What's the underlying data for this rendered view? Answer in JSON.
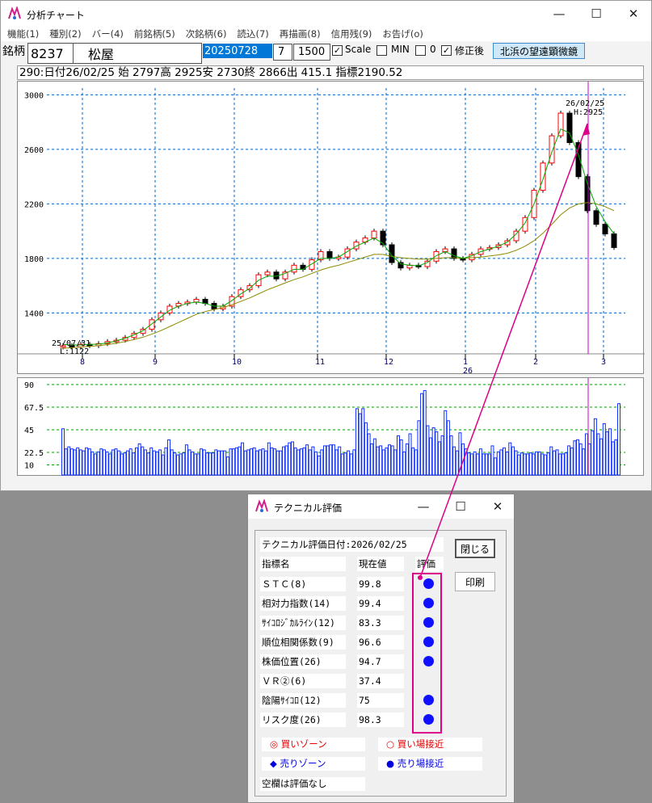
{
  "main_window": {
    "title": "分析チャート",
    "menu": [
      "機能(1)",
      "種別(2)",
      "バー(4)",
      "前銘柄(5)",
      "次銘柄(6)",
      "読込(7)",
      "再描画(8)",
      "信用残(9)",
      "お告げ(o)"
    ],
    "toolbar": {
      "stock_label": "銘柄",
      "code": "8237",
      "name": "松屋",
      "date": "20250728",
      "period": "7",
      "count": "1500",
      "scale_label": "Scale",
      "scale_checked": true,
      "min_label": "MIN",
      "min_checked": false,
      "zero_label": "0",
      "zero_checked": false,
      "adjusted_label": "修正後",
      "adjusted_checked": true,
      "telescope_button": "北浜の望遠顕微鏡"
    },
    "info_line": "290:日付26/02/25 始 2797高 2925安 2730終 2866出 415.1 指標2190.52"
  },
  "chart_data": [
    {
      "type": "candlestick",
      "y_ticks": [
        "3000",
        "2600",
        "2200",
        "1800",
        "1400"
      ],
      "ylim": [
        1100,
        3050
      ],
      "x_month_labels": [
        "8",
        "9",
        "10",
        "11",
        "12",
        "1",
        "2",
        "3"
      ],
      "x_year_label": "26",
      "annotation_high_date": "26/02/25",
      "annotation_high_value": "H:2925",
      "annotation_low_date": "25/07/31",
      "annotation_low_value": "L:1122",
      "grid": true,
      "close_approx": [
        1160,
        1150,
        1170,
        1160,
        1175,
        1190,
        1200,
        1220,
        1250,
        1280,
        1350,
        1400,
        1450,
        1470,
        1480,
        1500,
        1470,
        1430,
        1450,
        1520,
        1570,
        1600,
        1680,
        1700,
        1650,
        1700,
        1750,
        1720,
        1790,
        1850,
        1800,
        1810,
        1870,
        1920,
        1950,
        2000,
        1900,
        1770,
        1730,
        1750,
        1740,
        1780,
        1850,
        1870,
        1800,
        1790,
        1830,
        1870,
        1880,
        1900,
        1930,
        2000,
        2100,
        2300,
        2500,
        2700,
        2866,
        2650,
        2400,
        2150,
        2050,
        1980,
        1880
      ],
      "ma_short_approx": [
        1170,
        1165,
        1165,
        1168,
        1172,
        1180,
        1195,
        1215,
        1240,
        1270,
        1320,
        1370,
        1420,
        1450,
        1470,
        1480,
        1470,
        1450,
        1450,
        1490,
        1540,
        1580,
        1640,
        1670,
        1670,
        1690,
        1720,
        1720,
        1760,
        1800,
        1800,
        1810,
        1850,
        1890,
        1920,
        1950,
        1910,
        1820,
        1760,
        1750,
        1745,
        1770,
        1820,
        1850,
        1820,
        1800,
        1820,
        1850,
        1870,
        1890,
        1920,
        1980,
        2060,
        2200,
        2380,
        2580,
        2750,
        2720,
        2560,
        2350,
        2180,
        2070,
        1980
      ],
      "ma_long_approx": [
        1140,
        1145,
        1150,
        1155,
        1160,
        1168,
        1178,
        1190,
        1205,
        1222,
        1245,
        1270,
        1300,
        1330,
        1360,
        1390,
        1410,
        1425,
        1440,
        1460,
        1485,
        1510,
        1540,
        1570,
        1595,
        1620,
        1645,
        1665,
        1690,
        1715,
        1735,
        1750,
        1770,
        1790,
        1810,
        1830,
        1830,
        1815,
        1805,
        1800,
        1795,
        1795,
        1800,
        1805,
        1805,
        1800,
        1805,
        1810,
        1818,
        1826,
        1838,
        1860,
        1890,
        1930,
        1985,
        2050,
        2120,
        2170,
        2200,
        2210,
        2200,
        2180,
        2150
      ]
    },
    {
      "type": "bar",
      "y_ticks": [
        "90",
        "67.5",
        "45",
        "22.5",
        "10"
      ],
      "ylim": [
        0,
        90
      ],
      "values_approx": [
        46,
        26,
        28,
        26,
        25,
        27,
        25,
        24,
        27,
        26,
        23,
        21,
        23,
        26,
        25,
        23,
        21,
        25,
        26,
        24,
        21,
        22,
        24,
        26,
        22,
        27,
        31,
        28,
        25,
        22,
        27,
        24,
        23,
        25,
        20,
        27,
        35,
        25,
        22,
        20,
        21,
        22,
        30,
        25,
        23,
        21,
        21,
        26,
        25,
        22,
        22,
        22,
        25,
        24,
        24,
        24,
        18,
        26,
        26,
        27,
        28,
        32,
        24,
        25,
        26,
        27,
        24,
        25,
        26,
        24,
        32,
        27,
        26,
        24,
        24,
        28,
        29,
        32,
        33,
        27,
        25,
        26,
        27,
        30,
        25,
        28,
        23,
        19,
        25,
        29,
        29,
        30,
        30,
        25,
        28,
        21,
        22,
        24,
        21,
        25,
        66,
        61,
        66,
        52,
        41,
        31,
        36,
        28,
        29,
        25,
        27,
        30,
        29,
        25,
        39,
        35,
        23,
        31,
        41,
        27,
        25,
        54,
        81,
        84,
        49,
        37,
        47,
        43,
        33,
        39,
        64,
        54,
        39,
        28,
        24,
        42,
        31,
        26,
        22,
        21,
        23,
        21,
        26,
        21,
        21,
        21,
        29,
        17,
        23,
        25,
        27,
        23,
        32,
        28,
        24,
        20,
        22,
        21,
        21,
        22,
        21,
        23,
        23,
        21,
        20,
        22,
        28,
        24,
        25,
        21,
        21,
        22,
        29,
        27,
        34,
        35,
        31,
        26,
        41,
        31,
        44,
        56,
        41,
        36,
        51,
        43,
        46,
        33,
        35,
        71
      ]
    }
  ],
  "colors": {
    "bull_candle": "#ffffff",
    "bear_candle": "#000000",
    "candle_outline_up": "#ff0000",
    "ma_short": "#00aa00",
    "ma_long": "#8b8b00",
    "grid": "#0066cc",
    "volume_bar": "#1030ff",
    "marker_line": "#cc00cc",
    "arrow": "#dd0088",
    "eval_dot": "#1010ff",
    "buy_text": "#e00000",
    "sell_text": "#0000e0"
  },
  "tech_window": {
    "title": "テクニカル評価",
    "eval_date_label": "テクニカル評価日付:2026/02/25",
    "col_indicator": "指標名",
    "col_value": "現在値",
    "col_rating": "評価",
    "close_button": "閉じる",
    "print_button": "印刷",
    "rows": [
      {
        "name": "ＳＴＣ(8)",
        "value": "99.8",
        "rating": "sell-near"
      },
      {
        "name": "相対力指数(14)",
        "value": "99.4",
        "rating": "sell-near"
      },
      {
        "name": "ｻｲｺﾛｼﾞｶﾙﾗｲﾝ(12)",
        "value": "83.3",
        "rating": "sell-near"
      },
      {
        "name": "順位相関係数(9)",
        "value": "96.6",
        "rating": "sell-near"
      },
      {
        "name": "株価位置(26)",
        "value": "94.7",
        "rating": "sell-near"
      },
      {
        "name": "ＶＲ②(6)",
        "value": "37.4",
        "rating": ""
      },
      {
        "name": "陰陽ｻｲｺﾛ(12)",
        "value": "75",
        "rating": "sell-near"
      },
      {
        "name": "リスク度(26)",
        "value": "98.3",
        "rating": "sell-near"
      }
    ],
    "legend": {
      "buy_zone_symbol": "◎",
      "buy_zone": "買いゾーン",
      "buy_near_symbol": "○",
      "buy_near": "買い場接近",
      "sell_zone_symbol": "◆",
      "sell_zone": "売りゾーン",
      "sell_near_symbol": "●",
      "sell_near": "売り場接近",
      "blank_note": "空欄は評価なし"
    }
  }
}
